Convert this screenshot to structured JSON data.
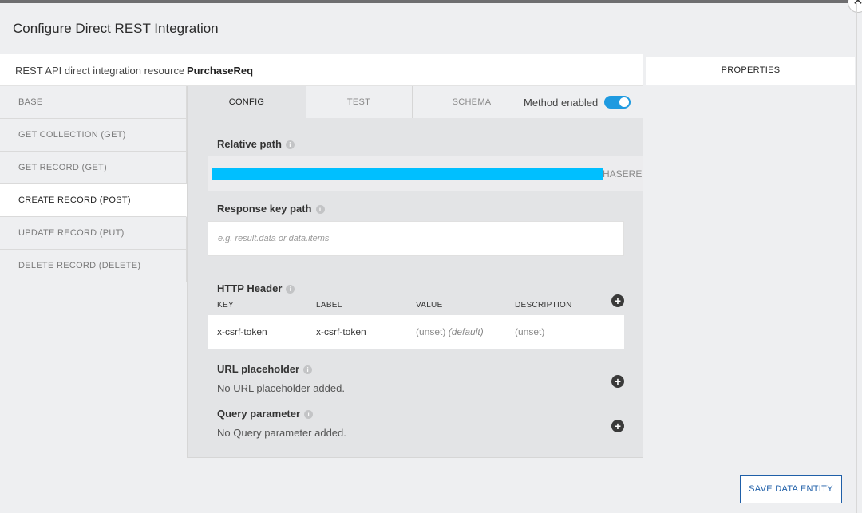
{
  "dialog": {
    "title": "Configure Direct REST Integration",
    "close_glyph": "✕"
  },
  "resource": {
    "label": "REST API direct integration resource",
    "name": "PurchaseReq"
  },
  "properties_panel": {
    "title": "PROPERTIES"
  },
  "sidebar": {
    "items": [
      {
        "label": "BASE",
        "active": false
      },
      {
        "label": "GET COLLECTION (GET)",
        "active": false
      },
      {
        "label": "GET RECORD (GET)",
        "active": false
      },
      {
        "label": "CREATE RECORD (POST)",
        "active": true
      },
      {
        "label": "UPDATE RECORD (PUT)",
        "active": false
      },
      {
        "label": "DELETE RECORD (DELETE)",
        "active": false
      }
    ]
  },
  "tabs": {
    "config": "CONFIG",
    "test": "TEST",
    "schema": "SCHEMA",
    "active": "CONFIG"
  },
  "method": {
    "label": "Method enabled",
    "enabled": true,
    "accent": "#1e9ae0"
  },
  "relative_path": {
    "label": "Relative path",
    "visible_suffix": "HASEREQ"
  },
  "response_key_path": {
    "label": "Response key path",
    "placeholder": "e.g. result.data or data.items",
    "value": ""
  },
  "http_header": {
    "label": "HTTP Header",
    "columns": [
      "KEY",
      "LABEL",
      "VALUE",
      "DESCRIPTION"
    ],
    "rows": [
      {
        "key": "x-csrf-token",
        "label": "x-csrf-token",
        "value": "(unset)",
        "value_note": "(default)",
        "description": "(unset)"
      }
    ]
  },
  "url_placeholder": {
    "label": "URL placeholder",
    "empty": "No URL placeholder added."
  },
  "query_parameter": {
    "label": "Query parameter",
    "empty": "No Query parameter added."
  },
  "icons": {
    "info": "i",
    "plus": "+"
  },
  "footer": {
    "save_label": "SAVE DATA ENTITY",
    "save_color": "#1f5fa8"
  }
}
